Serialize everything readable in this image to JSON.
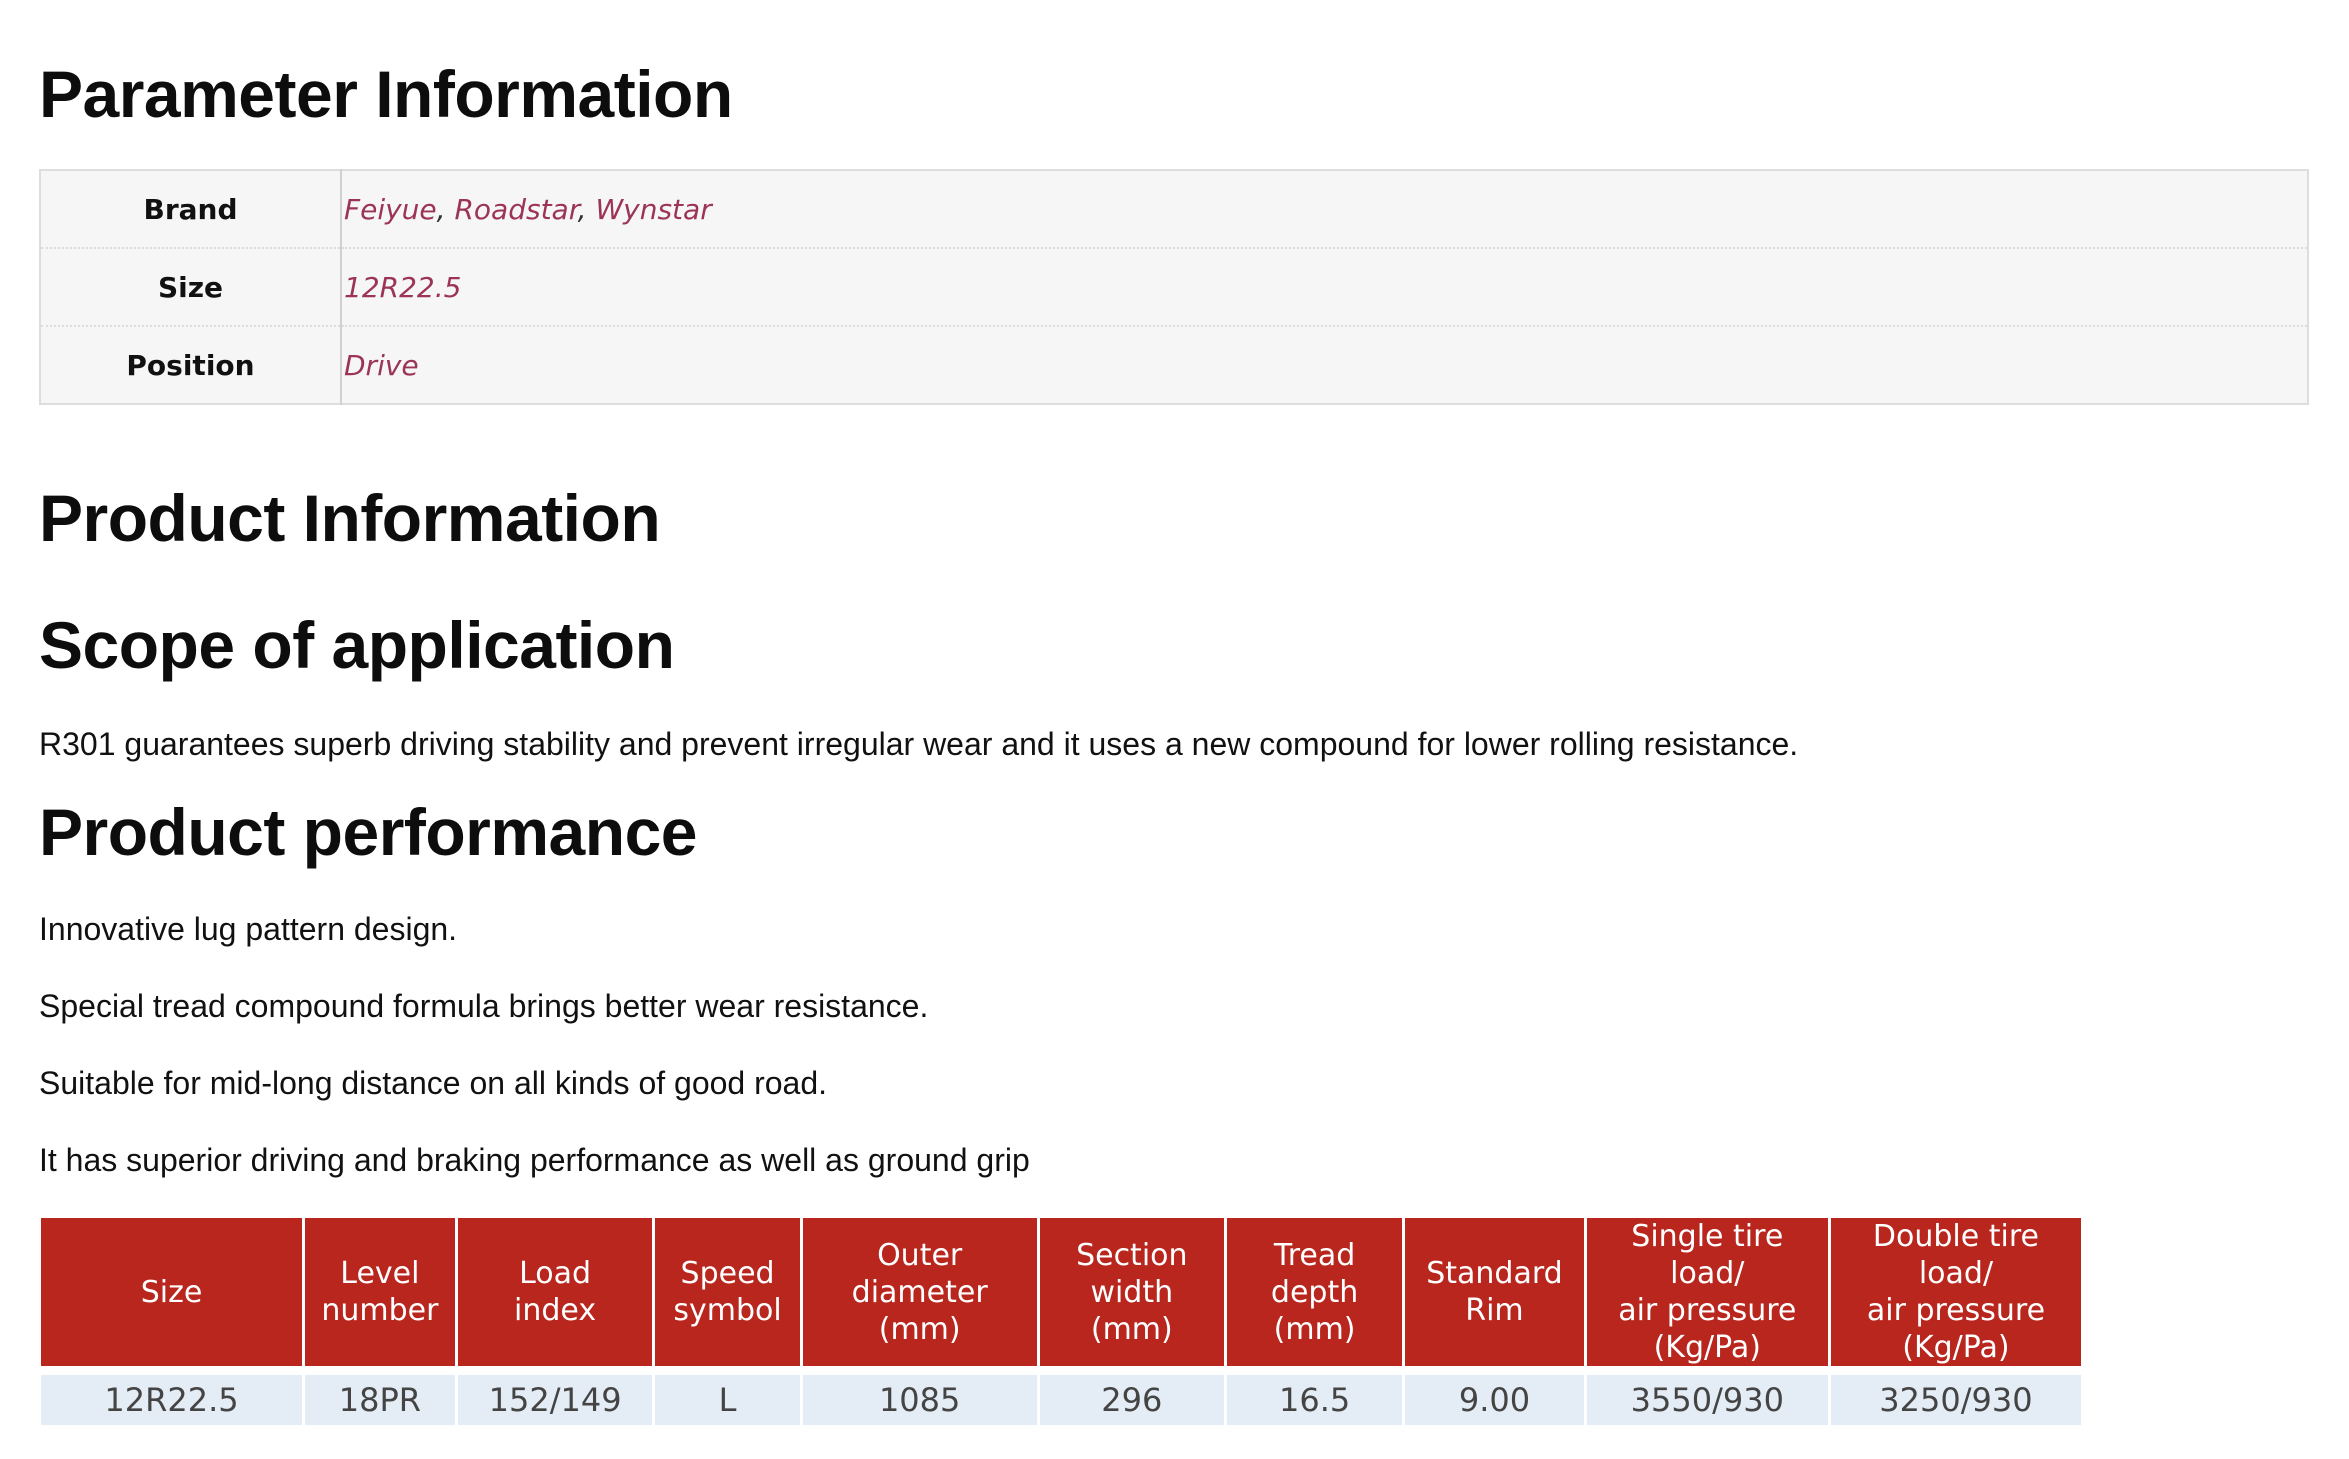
{
  "parameter_section": {
    "title": "Parameter Information",
    "rows": [
      {
        "label": "Brand",
        "values": [
          "Feiyue",
          "Roadstar",
          "Wynstar"
        ]
      },
      {
        "label": "Size",
        "values": [
          "12R22.5"
        ]
      },
      {
        "label": "Position",
        "values": [
          "Drive"
        ]
      }
    ],
    "separator": ", "
  },
  "product_section": {
    "title": "Product Information"
  },
  "scope_section": {
    "title": "Scope of application",
    "text": "R301 guarantees superb driving stability and prevent irregular wear and it uses a new compound for lower rolling resistance."
  },
  "performance_section": {
    "title": "Product performance",
    "lines": [
      "Innovative lug pattern design.",
      "Special tread compound formula brings better wear resistance.",
      "Suitable for mid-long distance on all kinds of good road.",
      "It has superior driving and braking performance as well as ground grip"
    ]
  },
  "spec_table": {
    "header_color": "#b8261e",
    "row_color": "#e4ecf5",
    "headers": [
      "Size",
      "Level\nnumber",
      "Load\nindex",
      "Speed\nsymbol",
      "Outer\ndiameter\n(mm)",
      "Section\nwidth\n(mm)",
      "Tread\ndepth\n(mm)",
      "Standard\nRim",
      "Single tire load/\nair pressure\n(Kg/Pa)",
      "Double tire load/\nair pressure\n(Kg/Pa)"
    ],
    "rows": [
      [
        "12R22.5",
        "18PR",
        "152/149",
        "L",
        "1085",
        "296",
        "16.5",
        "9.00",
        "3550/930",
        "3250/930"
      ]
    ]
  },
  "colors": {
    "link_value": "#9c3457",
    "param_bg": "#f6f6f6"
  }
}
